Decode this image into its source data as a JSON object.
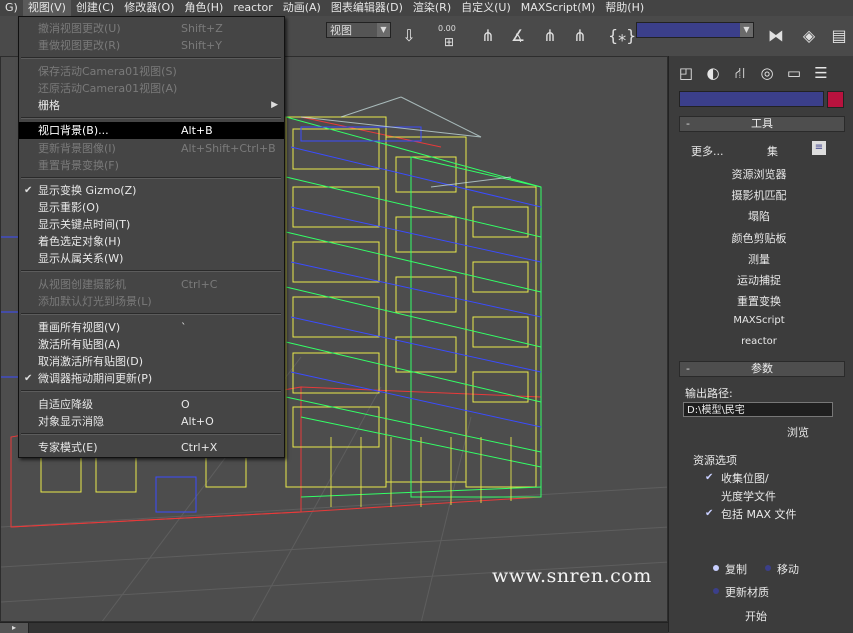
{
  "menubar": {
    "items": [
      "G)",
      "视图(V)",
      "创建(C)",
      "修改器(O)",
      "角色(H)",
      "reactor",
      "动画(A)",
      "图表编辑器(D)",
      "渲染(R)",
      "自定义(U)",
      "MAXScript(M)",
      "帮助(H)"
    ]
  },
  "toolbar": {
    "view_select": "视图",
    "counter": "0.00",
    "set_select": ""
  },
  "viewport_menu": {
    "items": [
      {
        "label": "撤消视图更改(U)",
        "shortcut": "Shift+Z",
        "disabled": true
      },
      {
        "label": "重做视图更改(R)",
        "shortcut": "Shift+Y",
        "disabled": true
      },
      {
        "label": "保存活动Camera01视图(S)",
        "shortcut": "",
        "disabled": true
      },
      {
        "label": "还原活动Camera01视图(A)",
        "shortcut": "",
        "disabled": true
      },
      {
        "label": "栅格",
        "shortcut": "",
        "disabled": false
      },
      {
        "label": "视口背景(B)...",
        "shortcut": "Alt+B",
        "disabled": false
      },
      {
        "label": "更新背景图像(I)",
        "shortcut": "Alt+Shift+Ctrl+B",
        "disabled": true
      },
      {
        "label": "重置背景变换(F)",
        "shortcut": "",
        "disabled": true
      },
      {
        "label": "显示变换 Gizmo(Z)",
        "shortcut": "",
        "disabled": false
      },
      {
        "label": "显示重影(O)",
        "shortcut": "",
        "disabled": false
      },
      {
        "label": "显示关键点时间(T)",
        "shortcut": "",
        "disabled": false
      },
      {
        "label": "着色选定对象(H)",
        "shortcut": "",
        "disabled": false
      },
      {
        "label": "显示从属关系(W)",
        "shortcut": "",
        "disabled": false
      },
      {
        "label": "从视图创建摄影机",
        "shortcut": "Ctrl+C",
        "disabled": true
      },
      {
        "label": "添加默认灯光到场景(L)",
        "shortcut": "",
        "disabled": true
      },
      {
        "label": "重画所有视图(V)",
        "shortcut": "`",
        "disabled": false
      },
      {
        "label": "激活所有贴图(A)",
        "shortcut": "",
        "disabled": false
      },
      {
        "label": "取消激活所有贴图(D)",
        "shortcut": "",
        "disabled": false
      },
      {
        "label": "微调器拖动期间更新(P)",
        "shortcut": "",
        "disabled": false
      },
      {
        "label": "自适应降级",
        "shortcut": "O",
        "disabled": false
      },
      {
        "label": "对象显示消隐",
        "shortcut": "Alt+O",
        "disabled": false
      },
      {
        "label": "专家模式(E)",
        "shortcut": "Ctrl+X",
        "disabled": false
      }
    ]
  },
  "viewport": {
    "watermark": "www.snren.com"
  },
  "utilities_panel": {
    "tools_rollout": "工具",
    "more_button": "更多...",
    "sets_button": "集",
    "tools": [
      "资源浏览器",
      "摄影机匹配",
      "塌陷",
      "颜色剪贴板",
      "测量",
      "运动捕捉",
      "重置变换",
      "MAXScript",
      "reactor"
    ],
    "params_rollout": "参数",
    "output_path_label": "输出路径:",
    "output_path_value": "D:\\模型\\民宅",
    "browse_button": "浏览",
    "resource_options_label": "资源选项",
    "collect_bitmaps_line1": "收集位图/",
    "collect_bitmaps_line2": "光度学文件",
    "include_max_file": "包括 MAX 文件",
    "copy_option": "复制",
    "move_option": "移动",
    "update_materials": "更新材质",
    "start_button": "开始"
  },
  "colors": {
    "accent_navy": "#3b3f8a",
    "object_color": "#b8123e",
    "menu_highlight": "#000000",
    "wire_green": "#33ff66",
    "wire_yellow": "#e9e94a",
    "wire_blue": "#3a4cff",
    "wire_red": "#e83a3a"
  }
}
